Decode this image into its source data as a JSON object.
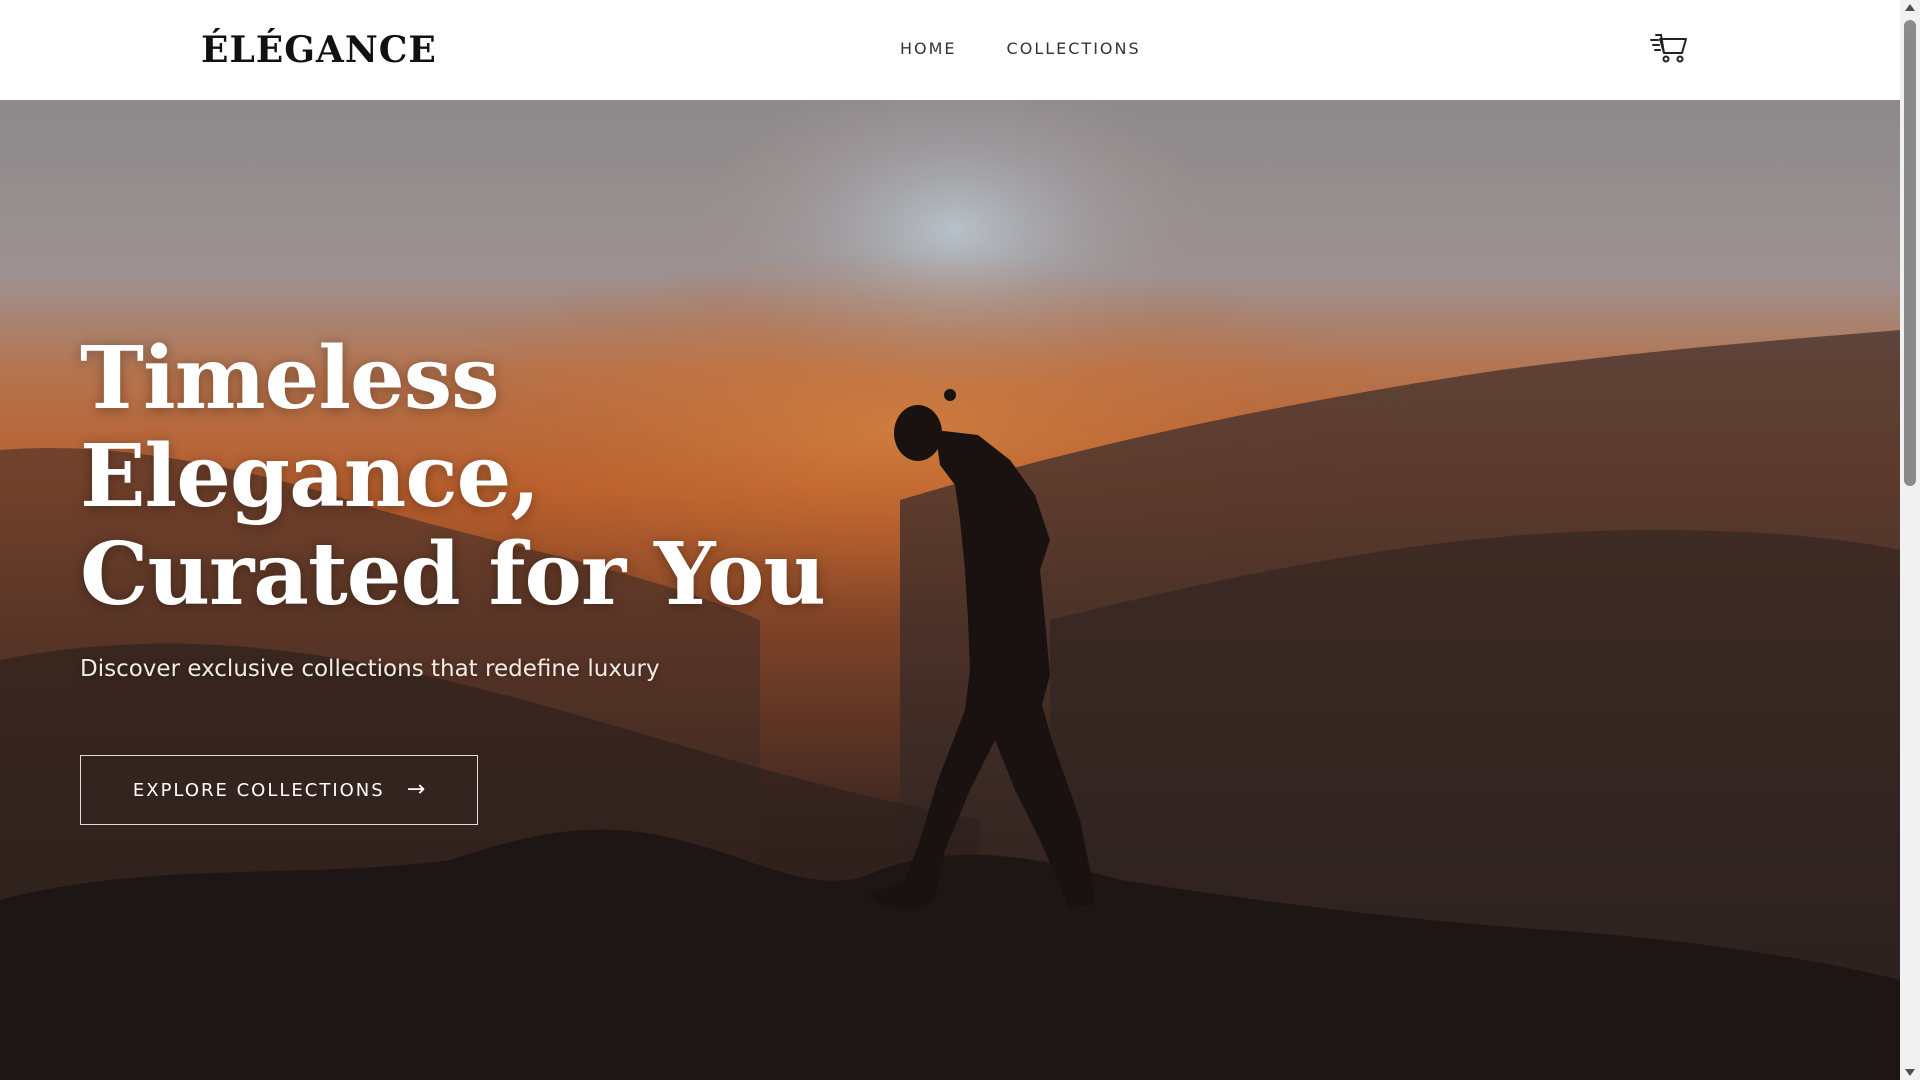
{
  "brand": {
    "logo_text": "ÉLÉGANCE"
  },
  "nav": {
    "items": [
      {
        "label": "HOME"
      },
      {
        "label": "COLLECTIONS"
      }
    ]
  },
  "header": {
    "cart_icon": "shopping-cart-icon"
  },
  "hero": {
    "title_lines": [
      "Timeless",
      "Elegance,",
      "Curated for You"
    ],
    "subtitle": "Discover exclusive collections that redefine luxury",
    "cta_label": "EXPLORE COLLECTIONS",
    "cta_icon": "arrow-right-icon"
  },
  "colors": {
    "header_bg": "#ffffff",
    "hero_text": "#ffffff",
    "sunset_orange": "#c0652e",
    "dark_ground": "#1e1614"
  }
}
